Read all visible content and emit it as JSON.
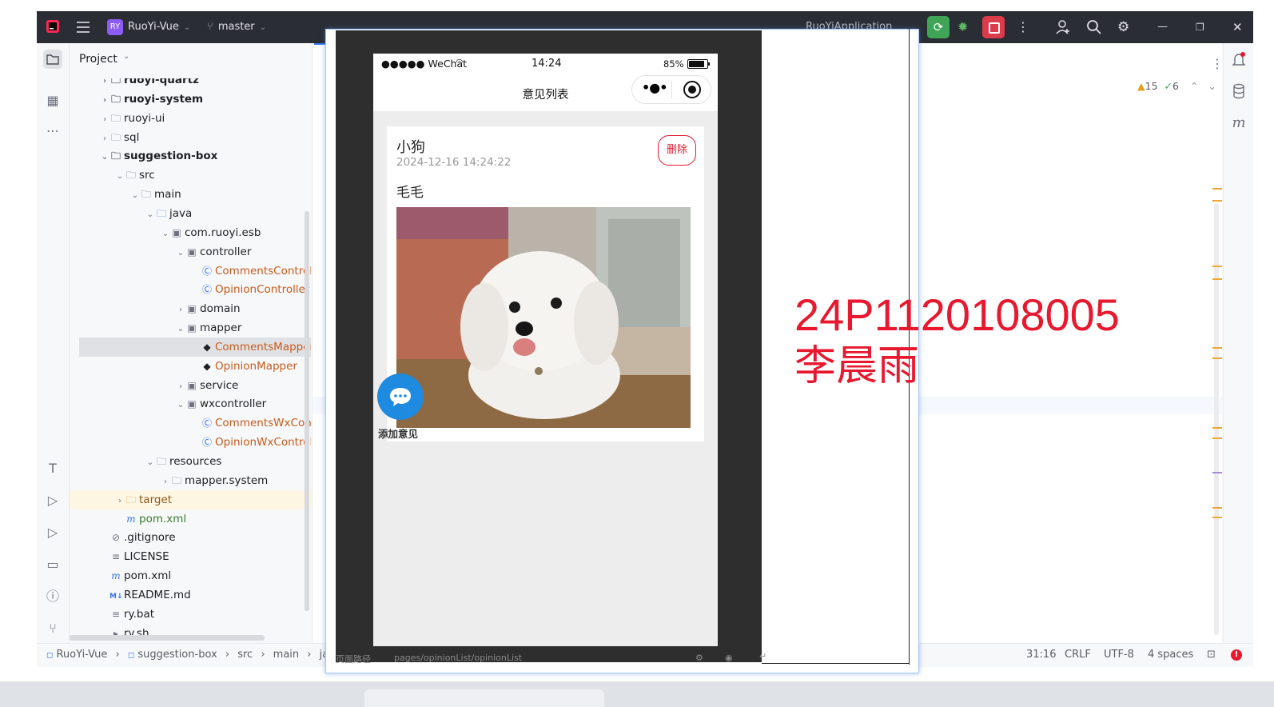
{
  "titlebar": {
    "project_badge": "RY",
    "project_name": "RuoYi-Vue",
    "branch": "master",
    "run_config": "RuoYiApplication"
  },
  "project_panel": {
    "title": "Project",
    "tree": [
      {
        "label": "ruoyi-quartz",
        "indent": 0,
        "chev": ">",
        "icon": "module-folder",
        "bold": true
      },
      {
        "label": "ruoyi-system",
        "indent": 0,
        "chev": ">",
        "icon": "module-folder",
        "bold": true
      },
      {
        "label": "ruoyi-ui",
        "indent": 0,
        "chev": ">",
        "icon": "folder",
        "bold": false
      },
      {
        "label": "sql",
        "indent": 0,
        "chev": ">",
        "icon": "folder",
        "bold": false
      },
      {
        "label": "suggestion-box",
        "indent": 0,
        "chev": "v",
        "icon": "module-folder",
        "bold": true
      },
      {
        "label": "src",
        "indent": 1,
        "chev": "v",
        "icon": "folder",
        "bold": false
      },
      {
        "label": "main",
        "indent": 2,
        "chev": "v",
        "icon": "folder",
        "bold": false
      },
      {
        "label": "java",
        "indent": 3,
        "chev": "v",
        "icon": "source-folder",
        "bold": false
      },
      {
        "label": "com.ruoyi.esb",
        "indent": 4,
        "chev": "v",
        "icon": "package",
        "bold": false
      },
      {
        "label": "controller",
        "indent": 5,
        "chev": "v",
        "icon": "package",
        "bold": false
      },
      {
        "label": "CommentsController",
        "indent": 6,
        "chev": "",
        "icon": "class",
        "bold": false,
        "color": "orange"
      },
      {
        "label": "OpinionController",
        "indent": 6,
        "chev": "",
        "icon": "class",
        "bold": false,
        "color": "orange"
      },
      {
        "label": "domain",
        "indent": 5,
        "chev": ">",
        "icon": "package",
        "bold": false
      },
      {
        "label": "mapper",
        "indent": 5,
        "chev": "v",
        "icon": "package",
        "bold": false
      },
      {
        "label": "CommentsMapper",
        "indent": 6,
        "chev": "",
        "icon": "mybatis",
        "bold": false,
        "color": "orange",
        "selected": true
      },
      {
        "label": "OpinionMapper",
        "indent": 6,
        "chev": "",
        "icon": "mybatis",
        "bold": false,
        "color": "orange"
      },
      {
        "label": "service",
        "indent": 5,
        "chev": ">",
        "icon": "package",
        "bold": false
      },
      {
        "label": "wxcontroller",
        "indent": 5,
        "chev": "v",
        "icon": "package",
        "bold": false
      },
      {
        "label": "CommentsWxController",
        "indent": 6,
        "chev": "",
        "icon": "class",
        "bold": false,
        "color": "orange"
      },
      {
        "label": "OpinionWxController",
        "indent": 6,
        "chev": "",
        "icon": "class",
        "bold": false,
        "color": "orange"
      },
      {
        "label": "resources",
        "indent": 3,
        "chev": "v",
        "icon": "resources-folder",
        "bold": false
      },
      {
        "label": "mapper.system",
        "indent": 4,
        "chev": ">",
        "icon": "folder",
        "bold": false
      },
      {
        "label": "target",
        "indent": 1,
        "chev": ">",
        "icon": "excluded-folder",
        "bold": false,
        "highlight": true,
        "color": "brown"
      },
      {
        "label": "pom.xml",
        "indent": 1,
        "chev": "",
        "icon": "maven",
        "bold": false,
        "color": "green"
      },
      {
        "label": ".gitignore",
        "indent": 0,
        "chev": "",
        "icon": "ignore",
        "bold": false
      },
      {
        "label": "LICENSE",
        "indent": 0,
        "chev": "",
        "icon": "text",
        "bold": false
      },
      {
        "label": "pom.xml",
        "indent": 0,
        "chev": "",
        "icon": "maven",
        "bold": false
      },
      {
        "label": "README.md",
        "indent": 0,
        "chev": "",
        "icon": "markdown",
        "bold": false
      },
      {
        "label": "ry.bat",
        "indent": 0,
        "chev": "",
        "icon": "text",
        "bold": false
      },
      {
        "label": "ry.sh",
        "indent": 0,
        "chev": "",
        "icon": "shell",
        "bold": false
      }
    ]
  },
  "editor": {
    "warnings": "15",
    "ok": "6"
  },
  "statusbar": {
    "breadcrumb": [
      "RuoYi-Vue",
      "suggestion-box",
      "src",
      "main",
      "jav"
    ],
    "position": "31:16",
    "line_ending": "CRLF",
    "encoding": "UTF-8",
    "indent": "4 spaces"
  },
  "phone": {
    "carrier": "●●●●● WeChat",
    "time": "14:24",
    "battery": "85%",
    "nav_title": "意见列表",
    "card": {
      "author": "小狗",
      "date": "2024-12-16 14:24:22",
      "delete_label": "删除",
      "content": "毛毛"
    },
    "fab_label": "添加意见"
  },
  "simulator_bottom": {
    "path_label": "页面路径",
    "path": "pages/opinionList/opinionList"
  },
  "watermark": {
    "line1": "24P1120108005",
    "line2": "李晨雨"
  },
  "colors": {
    "accent": "#3574f0",
    "watermark": "#e8182e",
    "delete": "#e8182e",
    "fab": "#1e8ae0"
  }
}
